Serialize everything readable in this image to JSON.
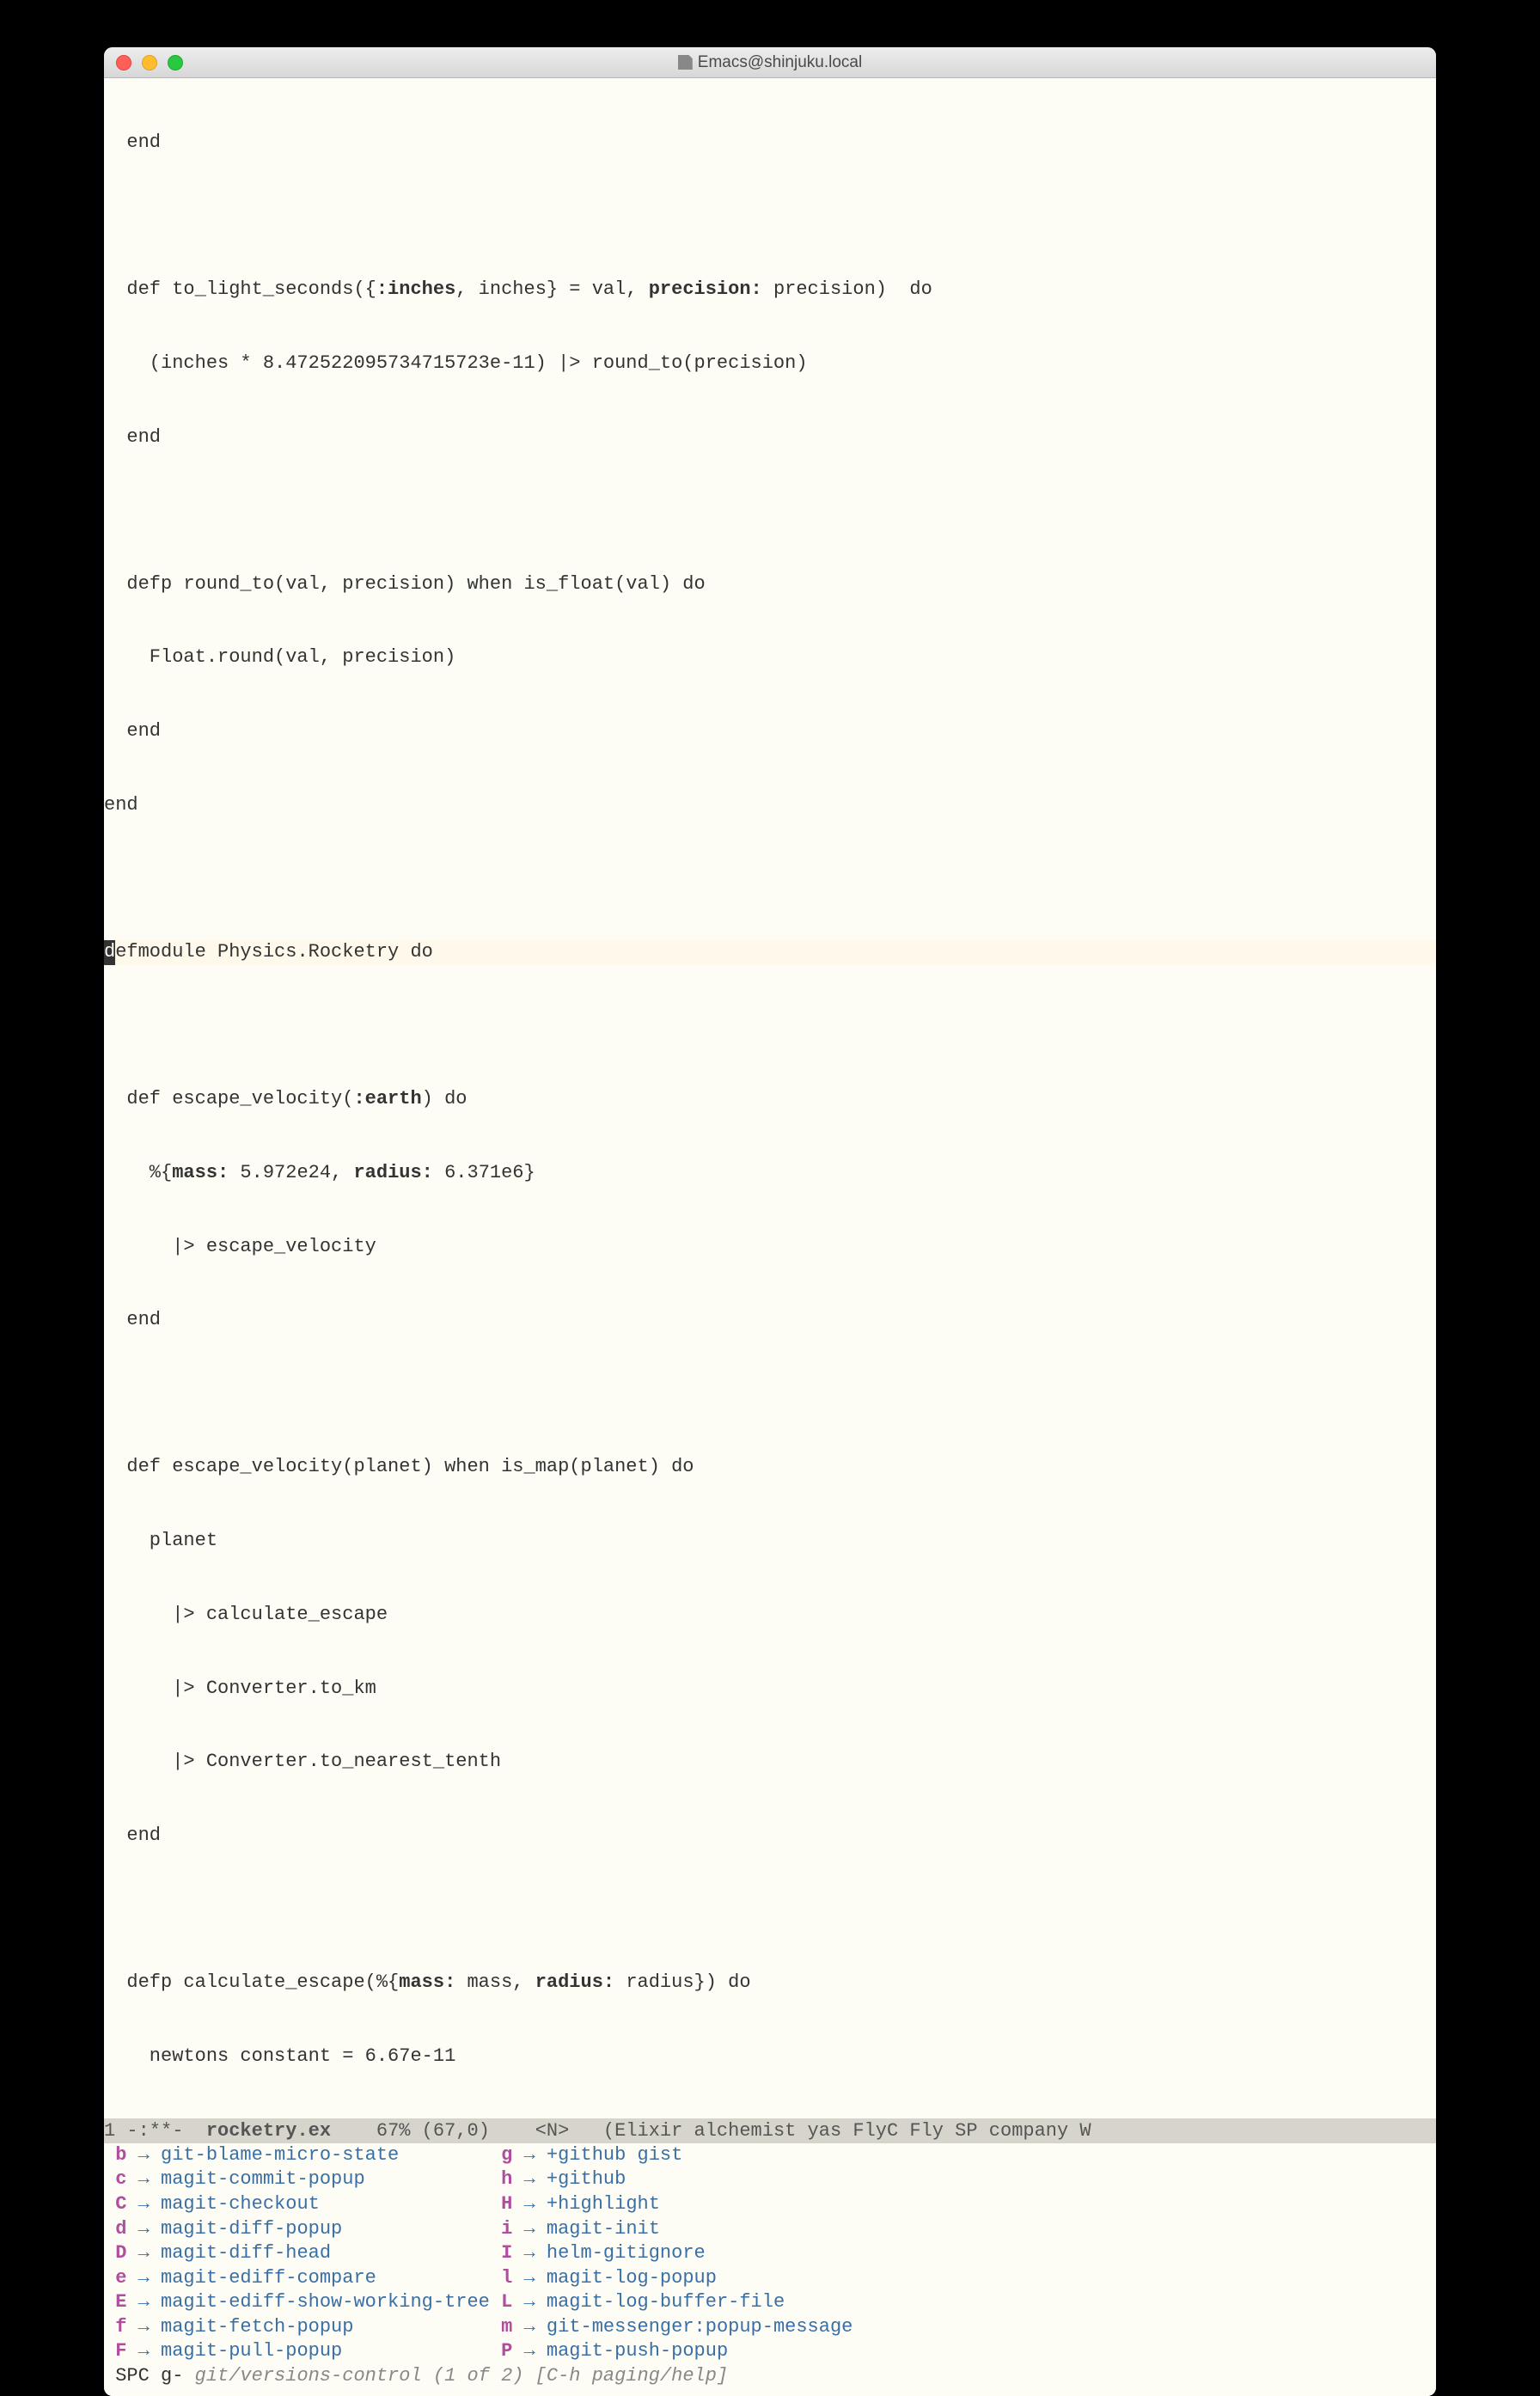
{
  "window": {
    "title": "Emacs@shinjuku.local"
  },
  "code": {
    "l1": "  end",
    "l2": "",
    "l3a": "  def to_light_seconds({",
    "l3b": ":inches",
    "l3c": ", inches} = val, ",
    "l3d": "precision:",
    "l3e": " precision)  do",
    "l4": "    (inches * 8.472522095734715723e-11) |> round_to(precision)",
    "l5": "  end",
    "l6": "",
    "l7": "  defp round_to(val, precision) when is_float(val) do",
    "l8": "    Float.round(val, precision)",
    "l9": "  end",
    "l10": "end",
    "l11": "",
    "l12a": "d",
    "l12b": "efmodule Physics.Rocketry do",
    "l13": "",
    "l14": "  def escape_velocity(",
    "l14b": ":earth",
    "l14c": ") do",
    "l15a": "    %{",
    "l15b": "mass:",
    "l15c": " 5.972e24, ",
    "l15d": "radius:",
    "l15e": " 6.371e6}",
    "l16": "      |> escape_velocity",
    "l17": "  end",
    "l18": "",
    "l19": "  def escape_velocity(planet) when is_map(planet) do",
    "l20": "    planet",
    "l21": "      |> calculate_escape",
    "l22": "      |> Converter.to_km",
    "l23": "      |> Converter.to_nearest_tenth",
    "l24": "  end",
    "l25": "",
    "l26a": "  defp calculate_escape(%{",
    "l26b": "mass:",
    "l26c": " mass, ",
    "l26d": "radius:",
    "l26e": " radius}) do",
    "l27": "    newtons constant = 6.67e-11"
  },
  "modeline": {
    "left": "1 -:**-  ",
    "file": "rocketry.ex",
    "mid": "    67% (67,0)    <N>   (Elixir alchemist yas FlyC Fly SP company W"
  },
  "keys": {
    "left": [
      {
        "k": "b",
        "cmd": "git-blame-micro-state"
      },
      {
        "k": "c",
        "cmd": "magit-commit-popup"
      },
      {
        "k": "C",
        "cmd": "magit-checkout"
      },
      {
        "k": "d",
        "cmd": "magit-diff-popup"
      },
      {
        "k": "D",
        "cmd": "magit-diff-head"
      },
      {
        "k": "e",
        "cmd": "magit-ediff-compare"
      },
      {
        "k": "E",
        "cmd": "magit-ediff-show-working-tree"
      },
      {
        "k": "f",
        "cmd": "magit-fetch-popup"
      },
      {
        "k": "F",
        "cmd": "magit-pull-popup"
      }
    ],
    "right": [
      {
        "k": "g",
        "cmd": "+github gist"
      },
      {
        "k": "h",
        "cmd": "+github"
      },
      {
        "k": "H",
        "cmd": "+highlight"
      },
      {
        "k": "i",
        "cmd": "magit-init"
      },
      {
        "k": "I",
        "cmd": "helm-gitignore"
      },
      {
        "k": "l",
        "cmd": "magit-log-popup"
      },
      {
        "k": "L",
        "cmd": "magit-log-buffer-file"
      },
      {
        "k": "m",
        "cmd": "git-messenger:popup-message"
      },
      {
        "k": "P",
        "cmd": "magit-push-popup"
      }
    ]
  },
  "minibuffer": {
    "prefix": " SPC g- ",
    "hint": "git/versions-control (1 of 2) [C-h paging/help]"
  }
}
